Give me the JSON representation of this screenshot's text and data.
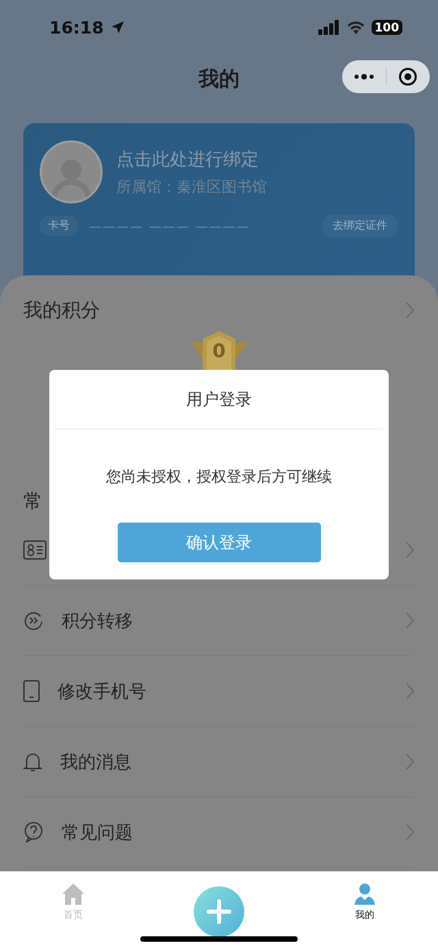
{
  "status_bar": {
    "time": "16:18",
    "battery": "100"
  },
  "nav": {
    "title": "我的"
  },
  "card": {
    "title": "点击此处进行绑定",
    "library": "所属馆：秦淮区图书馆",
    "card_label": "卡号",
    "card_number": "———— ——— ————",
    "bind_button": "去绑定证件"
  },
  "points": {
    "title": "我的积分",
    "value": "0"
  },
  "section": {
    "title": "常"
  },
  "menu": [
    {
      "kind": "id-card"
    },
    {
      "kind": "transfer",
      "label": "积分转移"
    },
    {
      "kind": "phone",
      "label": "修改手机号"
    },
    {
      "kind": "bell",
      "label": "我的消息"
    },
    {
      "kind": "help",
      "label": "常见问题"
    }
  ],
  "modal": {
    "title": "用户登录",
    "message": "您尚未授权，授权登录后方可继续",
    "button": "确认登录"
  },
  "tabs": [
    {
      "kind": "home",
      "label": "首页",
      "selected": false
    },
    {
      "kind": "add"
    },
    {
      "kind": "user",
      "label": "我的",
      "selected": true
    }
  ]
}
